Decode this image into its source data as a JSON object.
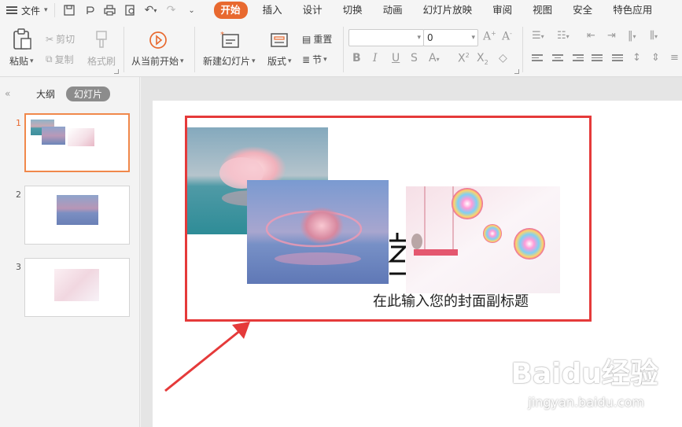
{
  "menu": {
    "file_label": "文件",
    "tabs": [
      {
        "label": "开始",
        "active": true
      },
      {
        "label": "插入"
      },
      {
        "label": "设计"
      },
      {
        "label": "切换"
      },
      {
        "label": "动画"
      },
      {
        "label": "幻灯片放映"
      },
      {
        "label": "审阅"
      },
      {
        "label": "视图"
      },
      {
        "label": "安全"
      },
      {
        "label": "特色应用"
      }
    ],
    "accent_color": "#e8692f"
  },
  "ribbon": {
    "paste": "粘贴",
    "cut": "剪切",
    "copy": "复制",
    "format_painter": "格式刷",
    "from_current": "从当前开始",
    "new_slide": "新建幻灯片",
    "layout": "版式",
    "reset": "重置",
    "section": "节",
    "font_size_value": "0"
  },
  "left_panel": {
    "outline_tab": "大纲",
    "slides_tab": "幻灯片",
    "thumbnails": [
      {
        "number": "1",
        "selected": true
      },
      {
        "number": "2"
      },
      {
        "number": "3"
      }
    ]
  },
  "slide": {
    "title_partial": "",
    "subtitle": "在此输入您的封面副标题"
  },
  "watermark": {
    "brand": "Baidu经验",
    "url": "jingyan.baidu.com"
  }
}
